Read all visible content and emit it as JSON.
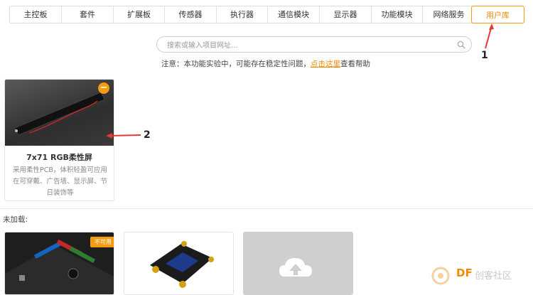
{
  "tabs": [
    {
      "label": "主控板",
      "w": 73
    },
    {
      "label": "套件",
      "w": 73
    },
    {
      "label": "扩展板",
      "w": 72
    },
    {
      "label": "传感器",
      "w": 73
    },
    {
      "label": "执行器",
      "w": 72
    },
    {
      "label": "通信模块",
      "w": 73
    },
    {
      "label": "显示器",
      "w": 73
    },
    {
      "label": "功能模块",
      "w": 72
    },
    {
      "label": "网络服务",
      "w": 73
    }
  ],
  "active_tab": "用户库",
  "search": {
    "placeholder": "搜索或输入项目网址..."
  },
  "notice": {
    "prefix": "注意：本功能实验中，可能存在稳定性问题，",
    "link": "点击这里",
    "suffix": "查看帮助"
  },
  "loaded": [
    {
      "title": "7x71 RGB柔性屏",
      "desc": "采用柔性PCB，体积轻盈可应用在可穿戴、广告墙、显示屏、节日装饰等"
    }
  ],
  "unloaded_label": "未加载:",
  "unloaded_badge": "不可用",
  "annotations": {
    "one": "1",
    "two": "2"
  },
  "watermark": {
    "brand": "DF",
    "text": "创客社区"
  },
  "colors": {
    "accent": "#f39c12",
    "annotation_arrow": "#e53935"
  }
}
